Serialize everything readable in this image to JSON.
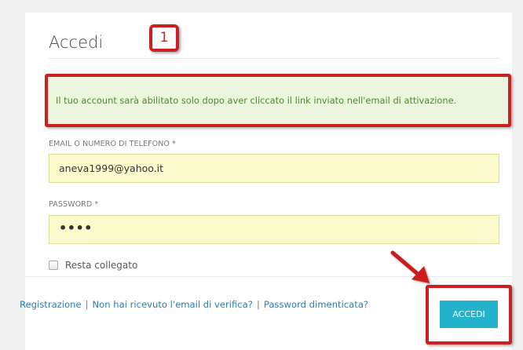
{
  "login": {
    "title": "Accedi",
    "callout_number": "1",
    "alert_message": "Il tuo account sarà abilitato solo dopo aver cliccato il link inviato nell'email di attivazione.",
    "email_label": "EMAIL O NUMERO DI TELEFONO *",
    "email_value": "aneva1999@yahoo.it",
    "password_label": "PASSWORD *",
    "password_value": "••••",
    "remember_label": "Resta collegato",
    "remember_checked": false,
    "submit_label": "ACCEDI"
  },
  "footer_links": {
    "register": "Registrazione",
    "no_email": "Non hai ricevuto l'email di verifica?",
    "forgot": "Password dimenticata?",
    "separator": "|"
  },
  "colors": {
    "annotation_red": "#cc1f1f",
    "alert_bg": "#ecf6df",
    "alert_text": "#4f8a2f",
    "input_bg": "#fbfbcd",
    "button_bg": "#22b2cc",
    "link": "#2b7cb2"
  },
  "icons": {
    "annotation_arrow": "arrow-icon",
    "checkbox": "checkbox-icon"
  }
}
